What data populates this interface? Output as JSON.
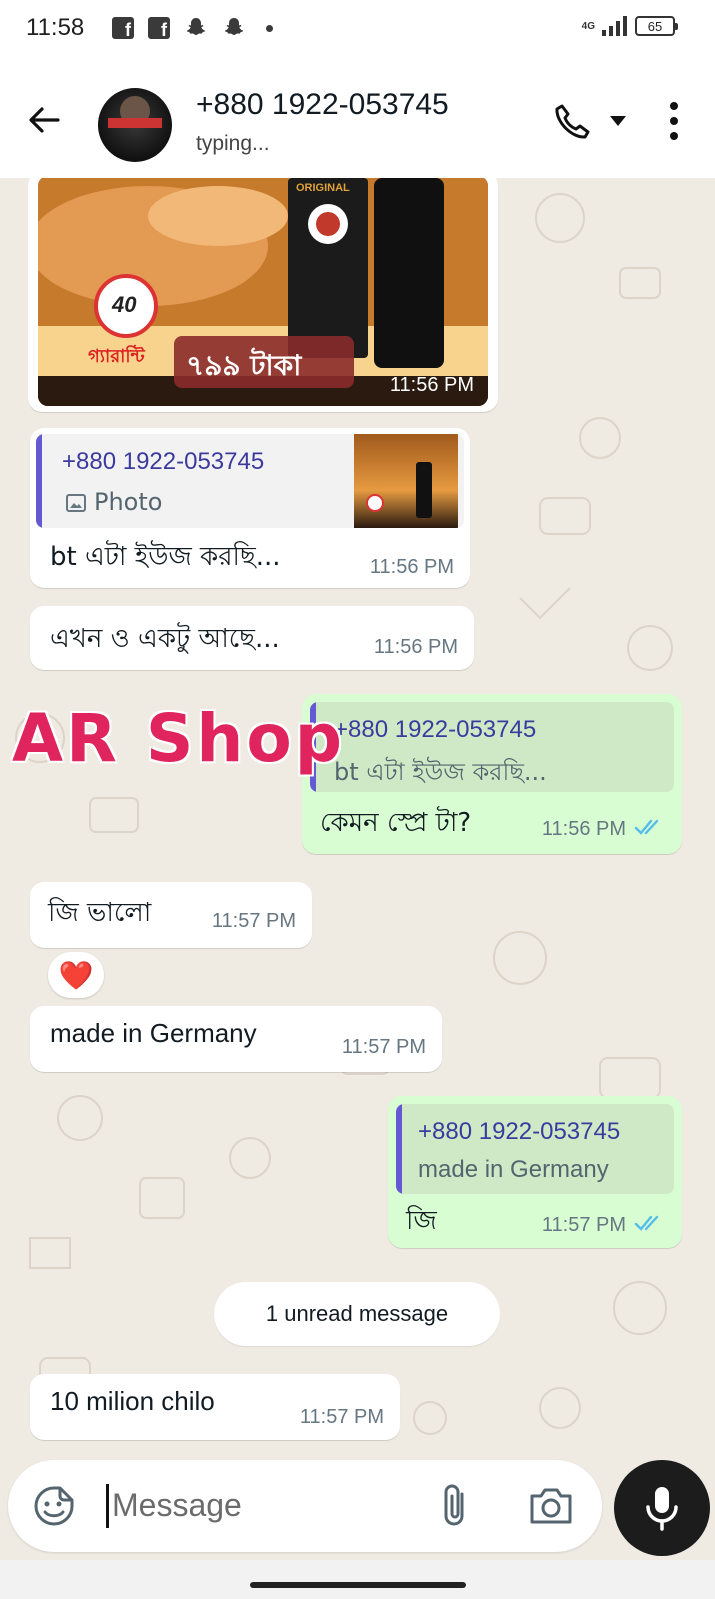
{
  "status_bar": {
    "time": "11:58",
    "network": "4G",
    "battery": "65"
  },
  "header": {
    "contact_name": "+880 1922-053745",
    "contact_status": "typing..."
  },
  "messages": [
    {
      "image_caption_price": "৭৯৯ টাকা",
      "image_badge_top": "40",
      "image_badge_text": "গ্যারান্টি",
      "image_product_tag": "ORIGINAL",
      "time": "11:56 PM",
      "direction": "in"
    },
    {
      "quote_name": "+880 1922-053745",
      "quote_text": "Photo",
      "text": "bt এটা ইউজ করছি...",
      "time": "11:56 PM",
      "direction": "in"
    },
    {
      "text": "এখন ও একটু আছে...",
      "time": "11:56 PM",
      "direction": "in"
    },
    {
      "quote_name": "+880 1922-053745",
      "quote_text": "bt এটা ইউজ করছি...",
      "text": "কেমন স্প্রে টা?",
      "time": "11:56 PM",
      "direction": "out"
    },
    {
      "text": "জি ভালো",
      "time": "11:57 PM",
      "direction": "in",
      "reaction": "❤️"
    },
    {
      "text": "made in Germany",
      "time": "11:57 PM",
      "direction": "in"
    },
    {
      "quote_name": "+880 1922-053745",
      "quote_text": "made in Germany",
      "text": "জি",
      "time": "11:57 PM",
      "direction": "out"
    },
    {
      "text": "10 milion chilo",
      "time": "11:57 PM",
      "direction": "in"
    }
  ],
  "unread_label": "1 unread message",
  "watermark": "AR Shop",
  "composer": {
    "placeholder": "Message"
  },
  "colors": {
    "outgoing_bubble": "#d9fdd3",
    "incoming_bubble": "#ffffff",
    "read_ticks": "#53bdeb",
    "quote_bar": "#6558d3",
    "watermark": "#e0245e"
  }
}
